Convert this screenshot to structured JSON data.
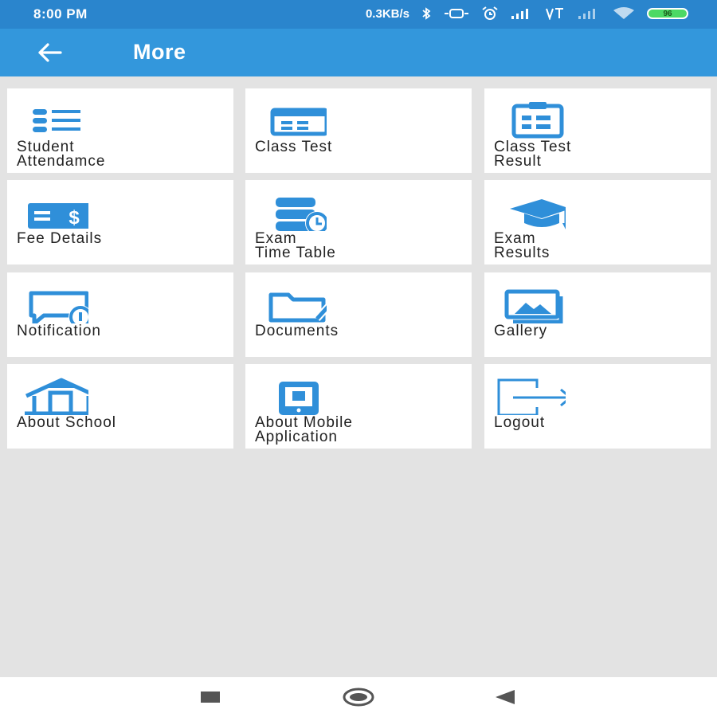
{
  "status_bar": {
    "time": "8:00 PM",
    "net_speed": "0.3KB/s",
    "battery": "96",
    "icons": [
      "bluetooth-icon",
      "vibrate-icon",
      "alarm-icon",
      "signal-icon",
      "volte-icon",
      "signal-icon",
      "wifi-icon"
    ]
  },
  "app_bar": {
    "title": "More",
    "back_icon": "back-arrow-icon"
  },
  "menu": [
    {
      "label": "Student\nAttendamce",
      "icon": "list-icon"
    },
    {
      "label": "Class Test",
      "icon": "calendar-card-icon"
    },
    {
      "label": "Class Test\nResult",
      "icon": "clipboard-icon"
    },
    {
      "label": "Fee Details",
      "icon": "money-icon"
    },
    {
      "label": "Exam\nTime Table",
      "icon": "database-clock-icon"
    },
    {
      "label": "Exam\nResults",
      "icon": "graduation-cap-icon"
    },
    {
      "label": "Notification",
      "icon": "message-alert-icon"
    },
    {
      "label": "Documents",
      "icon": "folder-edit-icon"
    },
    {
      "label": "Gallery",
      "icon": "image-gallery-icon"
    },
    {
      "label": "About School",
      "icon": "school-icon"
    },
    {
      "label": "About Mobile\nApplication",
      "icon": "tablet-icon"
    },
    {
      "label": "Logout",
      "icon": "logout-icon"
    }
  ],
  "nav_bar": {
    "buttons": [
      "recents-icon",
      "home-icon",
      "back-icon"
    ]
  },
  "colors": {
    "primary": "#3397dc",
    "status_bar": "#2a85cd",
    "icon": "#2f8fd9",
    "background": "#e3e3e3"
  }
}
